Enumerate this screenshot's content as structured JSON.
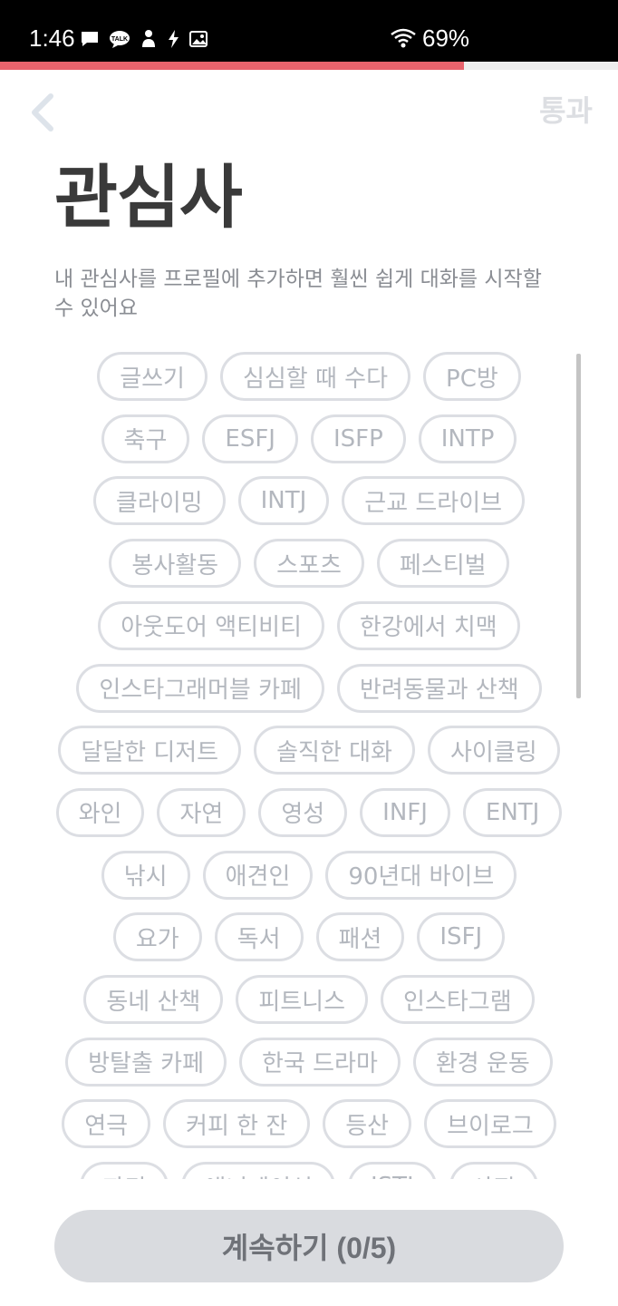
{
  "status_bar": {
    "time": "1:46",
    "battery": "69%",
    "icons": [
      "message-icon",
      "talk-icon",
      "person-icon",
      "flash-icon",
      "image-icon",
      "wifi-icon"
    ]
  },
  "progress": {
    "value": 0.75,
    "color": "#e8636c"
  },
  "header": {
    "back_icon": "chevron-left-icon",
    "skip_label": "통과"
  },
  "title": "관심사",
  "description": "내 관심사를 프로필에 추가하면 훨씬 쉽게 대화를 시작할 수 있어요",
  "interests": [
    [
      "글쓰기",
      "심심할 때 수다",
      "PC방"
    ],
    [
      "축구",
      "ESFJ",
      "ISFP",
      "INTP"
    ],
    [
      "클라이밍",
      "INTJ",
      "근교 드라이브"
    ],
    [
      "봉사활동",
      "스포츠",
      "페스티벌"
    ],
    [
      "아웃도어 액티비티",
      "한강에서 치맥"
    ],
    [
      "인스타그래머블 카페",
      "반려동물과 산책"
    ],
    [
      "달달한 디저트",
      "솔직한 대화",
      "사이클링"
    ],
    [
      "와인",
      "자연",
      "영성",
      "INFJ",
      "ENTJ"
    ],
    [
      "낚시",
      "애견인",
      "90년대 바이브"
    ],
    [
      "요가",
      "독서",
      "패션",
      "ISFJ"
    ],
    [
      "동네 산책",
      "피트니스",
      "인스타그램"
    ],
    [
      "방탈출 카페",
      "한국 드라마",
      "환경 운동"
    ],
    [
      "연극",
      "커피 한 잔",
      "등산",
      "브이로그"
    ],
    [
      "파티",
      "애니메이션",
      "ISTJ",
      "사진"
    ]
  ],
  "continue_button": {
    "label": "계속하기 (0/5)",
    "selected": 0,
    "max": 5
  },
  "colors": {
    "accent": "#e8636c",
    "chip_border": "#dcdee3",
    "chip_text": "#b3b7be",
    "title": "#3a3a3a",
    "button_bg": "#d9dbdf"
  }
}
